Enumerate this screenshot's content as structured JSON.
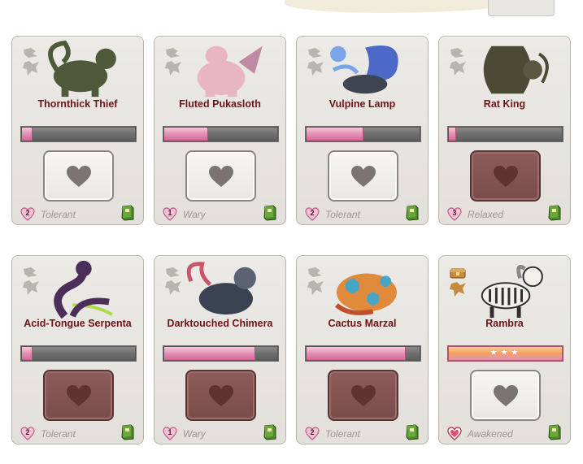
{
  "cards": [
    {
      "name": "Thornthick Thief",
      "progress": 0.1,
      "button_style": "light",
      "mood_num": "2",
      "mood": "Tolerant",
      "badge": "dragon-silhouette-icon",
      "art_color": "#4e5a3a"
    },
    {
      "name": "Fluted Pukasloth",
      "progress": 0.39,
      "button_style": "light",
      "mood_num": "1",
      "mood": "Wary",
      "badge": "dragon-silhouette-icon",
      "art_color": "#e7b6c2"
    },
    {
      "name": "Vulpine Lamp",
      "progress": 0.5,
      "button_style": "light",
      "mood_num": "2",
      "mood": "Tolerant",
      "badge": "dragon-silhouette-icon",
      "art_color": "#4c69c8"
    },
    {
      "name": "Rat King",
      "progress": 0.07,
      "button_style": "dark",
      "mood_num": "3",
      "mood": "Relaxed",
      "badge": "dragon-silhouette-icon",
      "art_color": "#4b4a34"
    },
    {
      "name": "Acid-Tongue Serpenta",
      "progress": 0.1,
      "button_style": "dark",
      "mood_num": "2",
      "mood": "Tolerant",
      "badge": "dragon-silhouette-icon",
      "art_color": "#4b2f5a"
    },
    {
      "name": "Darktouched Chimera",
      "progress": 0.8,
      "button_style": "dark",
      "mood_num": "1",
      "mood": "Wary",
      "badge": "dragon-silhouette-icon",
      "art_color": "#3a4150"
    },
    {
      "name": "Cactus Marzal",
      "progress": 0.87,
      "button_style": "dark",
      "mood_num": "2",
      "mood": "Tolerant",
      "badge": "dragon-silhouette-icon",
      "art_color": "#e08a3c"
    },
    {
      "name": "Rambra",
      "progress": 1.0,
      "button_style": "light",
      "mood_num": "",
      "mood": "Awakened",
      "badge": "treasure-chest-icon",
      "art_color": "#2e2e2e",
      "stars": "★★★"
    }
  ],
  "colors": {
    "name_text": "#6b1416",
    "mood_text": "#9a9793",
    "progress_fill": "#e48fb4",
    "awakened_fill": "#f3a25c"
  }
}
